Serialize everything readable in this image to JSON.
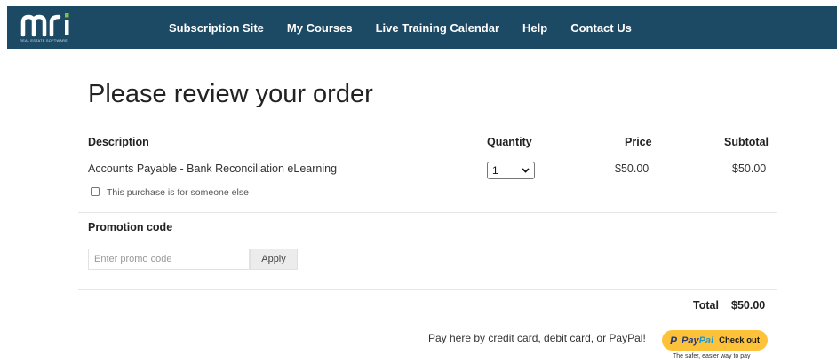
{
  "brand": {
    "logo_text": "mri",
    "logo_tagline": "REAL ESTATE SOFTWARE"
  },
  "nav": [
    {
      "label": "Subscription Site"
    },
    {
      "label": "My Courses"
    },
    {
      "label": "Live Training Calendar"
    },
    {
      "label": "Help"
    },
    {
      "label": "Contact Us"
    }
  ],
  "page_title": "Please review your order",
  "table": {
    "headers": {
      "description": "Description",
      "quantity": "Quantity",
      "price": "Price",
      "subtotal": "Subtotal"
    },
    "rows": [
      {
        "description": "Accounts Payable - Bank Reconciliation eLearning",
        "quantity": "1",
        "price": "$50.00",
        "subtotal": "$50.00",
        "gift_label": "This purchase is for someone else",
        "gift_checked": false
      }
    ]
  },
  "promo": {
    "title": "Promotion code",
    "placeholder": "Enter promo code",
    "apply_label": "Apply"
  },
  "total": {
    "label": "Total",
    "value": "$50.00"
  },
  "payment": {
    "text": "Pay here by credit card, debit card, or PayPal!",
    "paypal_brand_pay": "Pay",
    "paypal_brand_pal": "Pal",
    "paypal_action": "Check out",
    "paypal_tagline": "The safer, easier way to pay"
  },
  "colors": {
    "header_bg": "#1c4a64",
    "logo_accent": "#7cc242",
    "paypal_button": "#fec23a"
  }
}
